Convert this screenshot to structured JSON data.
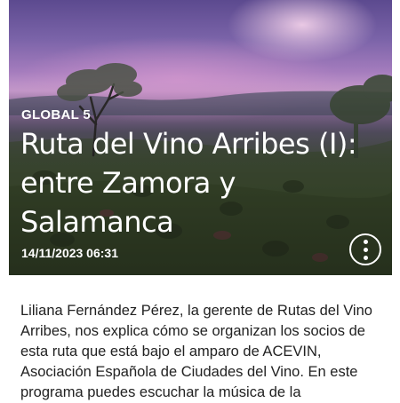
{
  "article": {
    "category": "GLOBAL 5",
    "title": "Ruta del Vino Arribes (I): entre Zamora y Salamanca",
    "date": "14/11/2023 06:31",
    "description": "Liliana Fernández Pérez, la gerente de Rutas del Vino Arribes, nos explica cómo se organizan los socios de esta ruta que está bajo el amparo de ACEVIN, Asociación Española de Ciudades del Vino. En este programa puedes escuchar la música de la"
  },
  "icons": {
    "more": "more-vertical-icon"
  },
  "colors": {
    "overlay_text": "#ffffff",
    "body_text": "#222222",
    "background": "#ffffff"
  }
}
